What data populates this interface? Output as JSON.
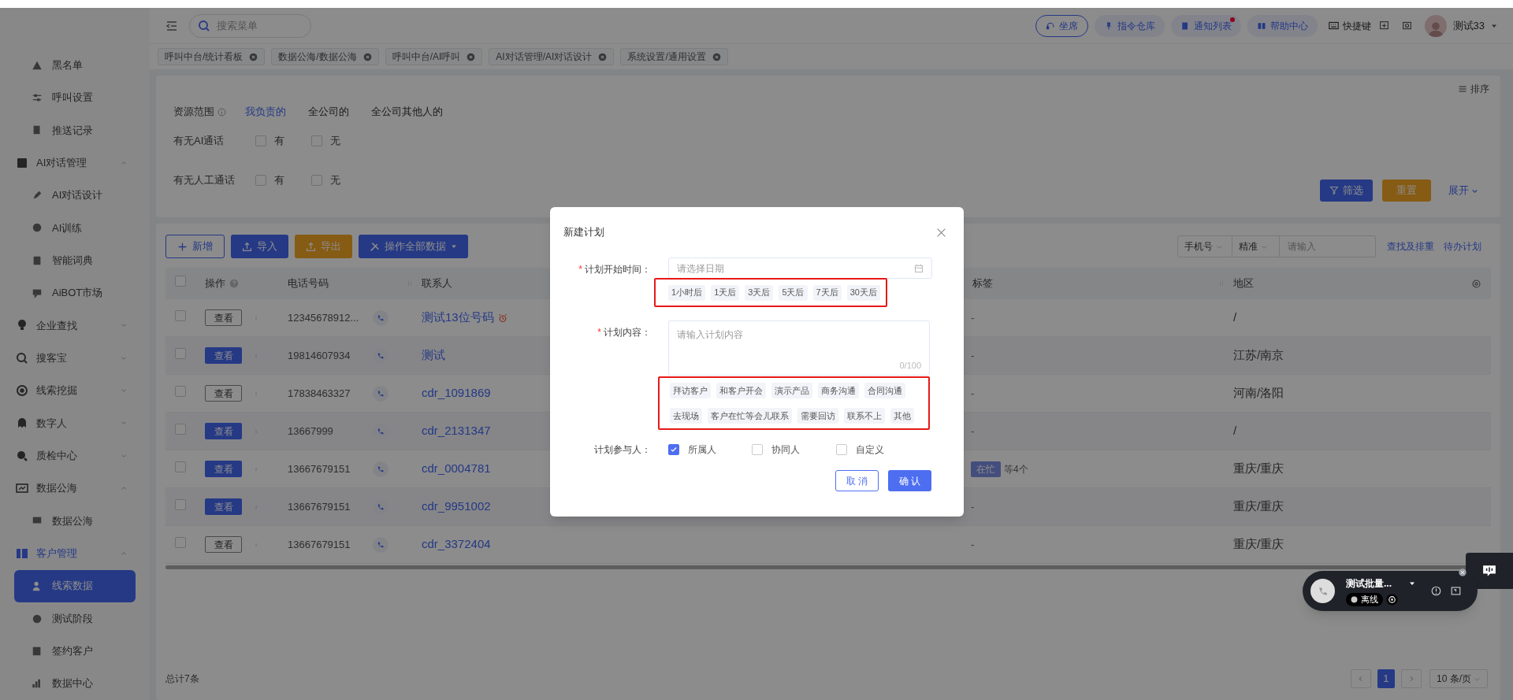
{
  "sidebar": {
    "items": [
      {
        "label": "黑名单",
        "kind": "sub",
        "selected": false
      },
      {
        "label": "呼叫设置",
        "kind": "sub",
        "selected": false
      },
      {
        "label": "推送记录",
        "kind": "sub",
        "selected": false
      },
      {
        "label": "AI对话管理",
        "kind": "group",
        "expanded": true,
        "active": false,
        "children": [
          {
            "label": "AI对话设计",
            "selected": false
          },
          {
            "label": "AI训练",
            "selected": false
          },
          {
            "label": "智能词典",
            "selected": false
          },
          {
            "label": "AiBOT市场",
            "selected": false
          }
        ]
      },
      {
        "label": "企业查找",
        "kind": "group",
        "expanded": false,
        "active": false
      },
      {
        "label": "搜客宝",
        "kind": "group",
        "expanded": false,
        "active": false
      },
      {
        "label": "线索挖掘",
        "kind": "group",
        "expanded": false,
        "active": false
      },
      {
        "label": "数字人",
        "kind": "group",
        "expanded": false,
        "active": false
      },
      {
        "label": "质检中心",
        "kind": "group",
        "expanded": false,
        "active": false
      },
      {
        "label": "数据公海",
        "kind": "group",
        "expanded": true,
        "active": false,
        "children": [
          {
            "label": "数据公海",
            "selected": false
          }
        ]
      },
      {
        "label": "客户管理",
        "kind": "group",
        "expanded": true,
        "active": true,
        "children": [
          {
            "label": "线索数据",
            "selected": true
          },
          {
            "label": "测试阶段",
            "selected": false
          },
          {
            "label": "签约客户",
            "selected": false
          },
          {
            "label": "数据中心",
            "selected": false
          }
        ]
      }
    ]
  },
  "topbar": {
    "search": {
      "placeholder": "搜索菜单"
    },
    "pills": [
      {
        "label": "坐席",
        "badge": false
      },
      {
        "label": "指令仓库",
        "badge": false
      },
      {
        "label": "通知列表",
        "badge": true
      },
      {
        "label": "帮助中心",
        "badge": false
      }
    ],
    "shortcut": "快捷键",
    "user": "测试33"
  },
  "tabs": [
    {
      "label": "呼叫中台/统计看板"
    },
    {
      "label": "数据公海/数据公海"
    },
    {
      "label": "呼叫中台/AI呼叫"
    },
    {
      "label": "AI对话管理/AI对话设计"
    },
    {
      "label": "系统设置/通用设置"
    }
  ],
  "filters": {
    "scope": {
      "label": "资源范围",
      "options": [
        {
          "label": "我负责的",
          "selected": true
        },
        {
          "label": "全公司的",
          "selected": false
        },
        {
          "label": "全公司其他人的",
          "selected": false
        }
      ]
    },
    "checks": [
      {
        "label": "有无AI通话",
        "options": [
          {
            "label": "有",
            "checked": false
          },
          {
            "label": "无",
            "checked": false
          }
        ]
      },
      {
        "label": "有无人工通话",
        "options": [
          {
            "label": "有",
            "checked": false
          },
          {
            "label": "无",
            "checked": false
          }
        ]
      }
    ],
    "sort": "排序",
    "filter_button": "筛选",
    "reset_button": "重置",
    "expand_link": "展开"
  },
  "toolbar": {
    "buttons": [
      {
        "label": "新增",
        "kind": "outline"
      },
      {
        "label": "导入",
        "kind": "primary"
      },
      {
        "label": "导出",
        "kind": "warning"
      },
      {
        "label": "操作全部数据",
        "kind": "dropdown"
      }
    ],
    "search": {
      "field": "手机号",
      "mode": "精准",
      "placeholder": "请输入"
    },
    "links": [
      "查找及排重",
      "待办计划"
    ]
  },
  "table": {
    "select_all_checked": false,
    "columns": [
      "操作",
      "电话号码",
      "联系人",
      "标签",
      "地区"
    ],
    "rows": [
      {
        "checked": false,
        "view": "查看",
        "primary": false,
        "phone": "12345678912...",
        "contact": "测试13位号码",
        "reminder": true,
        "tag": "-",
        "region": "/"
      },
      {
        "checked": false,
        "view": "查看",
        "primary": true,
        "phone": "19814607934",
        "contact": "测试",
        "reminder": false,
        "tag": "-",
        "region": "江苏/南京"
      },
      {
        "checked": false,
        "view": "查看",
        "primary": false,
        "phone": "17838463327",
        "contact": "cdr_1091869",
        "reminder": false,
        "tag": "-",
        "region": "河南/洛阳"
      },
      {
        "checked": false,
        "view": "查看",
        "primary": true,
        "phone": "13667999",
        "contact": "cdr_2131347",
        "reminder": false,
        "tag": "-",
        "region": "/"
      },
      {
        "checked": false,
        "view": "查看",
        "primary": true,
        "phone": "13667679151",
        "contact": "cdr_0004781",
        "reminder": false,
        "tag_chip": "在忙",
        "tag_more": "等4个",
        "region": "重庆/重庆"
      },
      {
        "checked": false,
        "view": "查看",
        "primary": true,
        "phone": "13667679151",
        "contact": "cdr_9951002",
        "reminder": false,
        "tag": "-",
        "region": "重庆/重庆"
      },
      {
        "checked": false,
        "view": "查看",
        "primary": false,
        "phone": "13667679151",
        "contact": "cdr_3372404",
        "reminder": false,
        "tag": "-",
        "region": "重庆/重庆"
      }
    ]
  },
  "footer": {
    "total": "总计7条",
    "pages": [
      {
        "label": "1",
        "selected": true
      }
    ],
    "page_size": "10 条/页"
  },
  "modal": {
    "title": "新建计划",
    "start": {
      "required_mark": "*",
      "label": "计划开始时间：",
      "placeholder": "请选择日期",
      "chips": [
        "1小时后",
        "1天后",
        "3天后",
        "5天后",
        "7天后",
        "30天后"
      ]
    },
    "content": {
      "required_mark": "*",
      "label": "计划内容：",
      "placeholder": "请输入计划内容",
      "counter": "0/100",
      "chips": [
        "拜访客户",
        "和客户开会",
        "演示产品",
        "商务沟通",
        "合同沟通",
        "去现场",
        "客户在忙等会儿联系",
        "需要回访",
        "联系不上",
        "其他"
      ]
    },
    "participants": {
      "label": "计划参与人：",
      "options": [
        {
          "label": "所属人",
          "checked": true
        },
        {
          "label": "协同人",
          "checked": false
        },
        {
          "label": "自定义",
          "checked": false
        }
      ]
    },
    "cancel": "取 消",
    "confirm": "确 认"
  },
  "call_widget": {
    "name": "测试批量...",
    "status": "离线"
  }
}
